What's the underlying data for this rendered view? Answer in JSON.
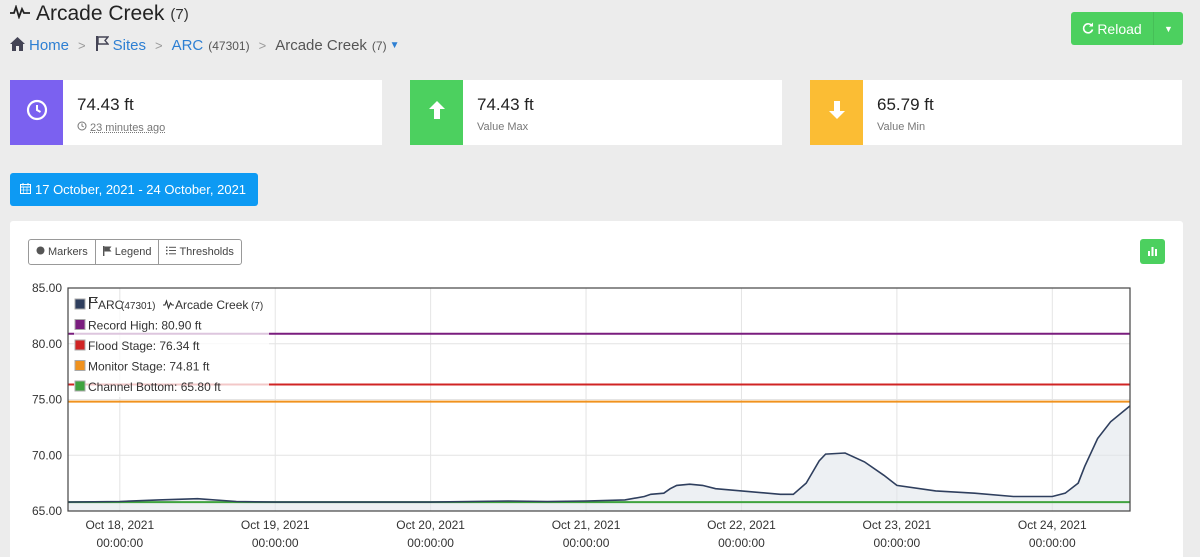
{
  "header": {
    "title": "Arcade Creek",
    "title_count": "(7)",
    "pulse_icon": "pulse-icon"
  },
  "breadcrumb": {
    "home": "Home",
    "sites": "Sites",
    "arc": "ARC",
    "arc_id": "(47301)",
    "current": "Arcade Creek",
    "current_count": "(7)"
  },
  "reload": {
    "label": "Reload"
  },
  "stats": [
    {
      "value": "74.43 ft",
      "sub": "23 minutes ago",
      "icon": "clock-icon",
      "color": "#7b61f0"
    },
    {
      "value": "74.43 ft",
      "sub": "Value Max",
      "icon": "arrow-up-icon",
      "color": "#4cd05f"
    },
    {
      "value": "65.79 ft",
      "sub": "Value Min",
      "icon": "arrow-down-icon",
      "color": "#fbbd34"
    }
  ],
  "daterange": {
    "label": "17 October, 2021 - 24 October, 2021"
  },
  "toolbar": {
    "markers": "Markers",
    "legend": "Legend",
    "thresholds": "Thresholds"
  },
  "legend": {
    "series_site": "ARC",
    "series_site_id": "(47301)",
    "series_name": "Arcade Creek",
    "series_count": "(7)",
    "record_high": "Record High: 80.90 ft",
    "flood_stage": "Flood Stage: 76.34 ft",
    "monitor_stage": "Monitor Stage: 74.81 ft",
    "channel_bottom": "Channel Bottom: 65.80 ft"
  },
  "colors": {
    "series": "#2f3f5e",
    "record_high": "#7a1d7e",
    "flood_stage": "#d02424",
    "monitor_stage": "#f0921e",
    "channel_bottom": "#3fa33f",
    "accent_blue": "#0d9af3",
    "accent_green": "#4cd05f"
  },
  "chart_data": {
    "type": "area",
    "ylim": [
      65,
      85
    ],
    "xlim": [
      "2021-10-17 16:00",
      "2021-10-24 12:00"
    ],
    "yticks": [
      "85.00",
      "80.00",
      "75.00",
      "70.00",
      "65.00"
    ],
    "xticks": [
      {
        "date": "Oct 18, 2021",
        "time": "00:00:00"
      },
      {
        "date": "Oct 19, 2021",
        "time": "00:00:00"
      },
      {
        "date": "Oct 20, 2021",
        "time": "00:00:00"
      },
      {
        "date": "Oct 21, 2021",
        "time": "00:00:00"
      },
      {
        "date": "Oct 22, 2021",
        "time": "00:00:00"
      },
      {
        "date": "Oct 23, 2021",
        "time": "00:00:00"
      },
      {
        "date": "Oct 24, 2021",
        "time": "00:00:00"
      }
    ],
    "thresholds": [
      {
        "label": "Record High",
        "value": 80.9
      },
      {
        "label": "Flood Stage",
        "value": 76.34
      },
      {
        "label": "Monitor Stage",
        "value": 74.81
      },
      {
        "label": "Channel Bottom",
        "value": 65.8
      }
    ],
    "series": [
      {
        "name": "Arcade Creek",
        "points": [
          [
            "2021-10-17 16:00",
            65.8
          ],
          [
            "2021-10-18 00:00",
            65.85
          ],
          [
            "2021-10-18 06:00",
            66.0
          ],
          [
            "2021-10-18 12:00",
            66.1
          ],
          [
            "2021-10-18 18:00",
            65.85
          ],
          [
            "2021-10-19 00:00",
            65.8
          ],
          [
            "2021-10-19 12:00",
            65.8
          ],
          [
            "2021-10-20 00:00",
            65.8
          ],
          [
            "2021-10-20 12:00",
            65.9
          ],
          [
            "2021-10-20 18:00",
            65.85
          ],
          [
            "2021-10-21 00:00",
            65.9
          ],
          [
            "2021-10-21 06:00",
            66.0
          ],
          [
            "2021-10-21 09:00",
            66.3
          ],
          [
            "2021-10-21 10:00",
            66.5
          ],
          [
            "2021-10-21 12:00",
            66.6
          ],
          [
            "2021-10-21 13:00",
            67.0
          ],
          [
            "2021-10-21 14:00",
            67.3
          ],
          [
            "2021-10-21 16:00",
            67.4
          ],
          [
            "2021-10-21 18:00",
            67.3
          ],
          [
            "2021-10-21 20:00",
            67.0
          ],
          [
            "2021-10-22 00:00",
            66.8
          ],
          [
            "2021-10-22 06:00",
            66.5
          ],
          [
            "2021-10-22 08:00",
            66.5
          ],
          [
            "2021-10-22 10:00",
            67.5
          ],
          [
            "2021-10-22 12:00",
            69.5
          ],
          [
            "2021-10-22 13:00",
            70.1
          ],
          [
            "2021-10-22 16:00",
            70.2
          ],
          [
            "2021-10-22 19:00",
            69.4
          ],
          [
            "2021-10-22 22:00",
            68.2
          ],
          [
            "2021-10-23 00:00",
            67.3
          ],
          [
            "2021-10-23 06:00",
            66.8
          ],
          [
            "2021-10-23 12:00",
            66.6
          ],
          [
            "2021-10-23 18:00",
            66.3
          ],
          [
            "2021-10-24 00:00",
            66.3
          ],
          [
            "2021-10-24 02:00",
            66.6
          ],
          [
            "2021-10-24 04:00",
            67.5
          ],
          [
            "2021-10-24 05:00",
            69.0
          ],
          [
            "2021-10-24 07:00",
            71.5
          ],
          [
            "2021-10-24 09:00",
            73.0
          ],
          [
            "2021-10-24 12:00",
            74.43
          ]
        ]
      }
    ]
  }
}
